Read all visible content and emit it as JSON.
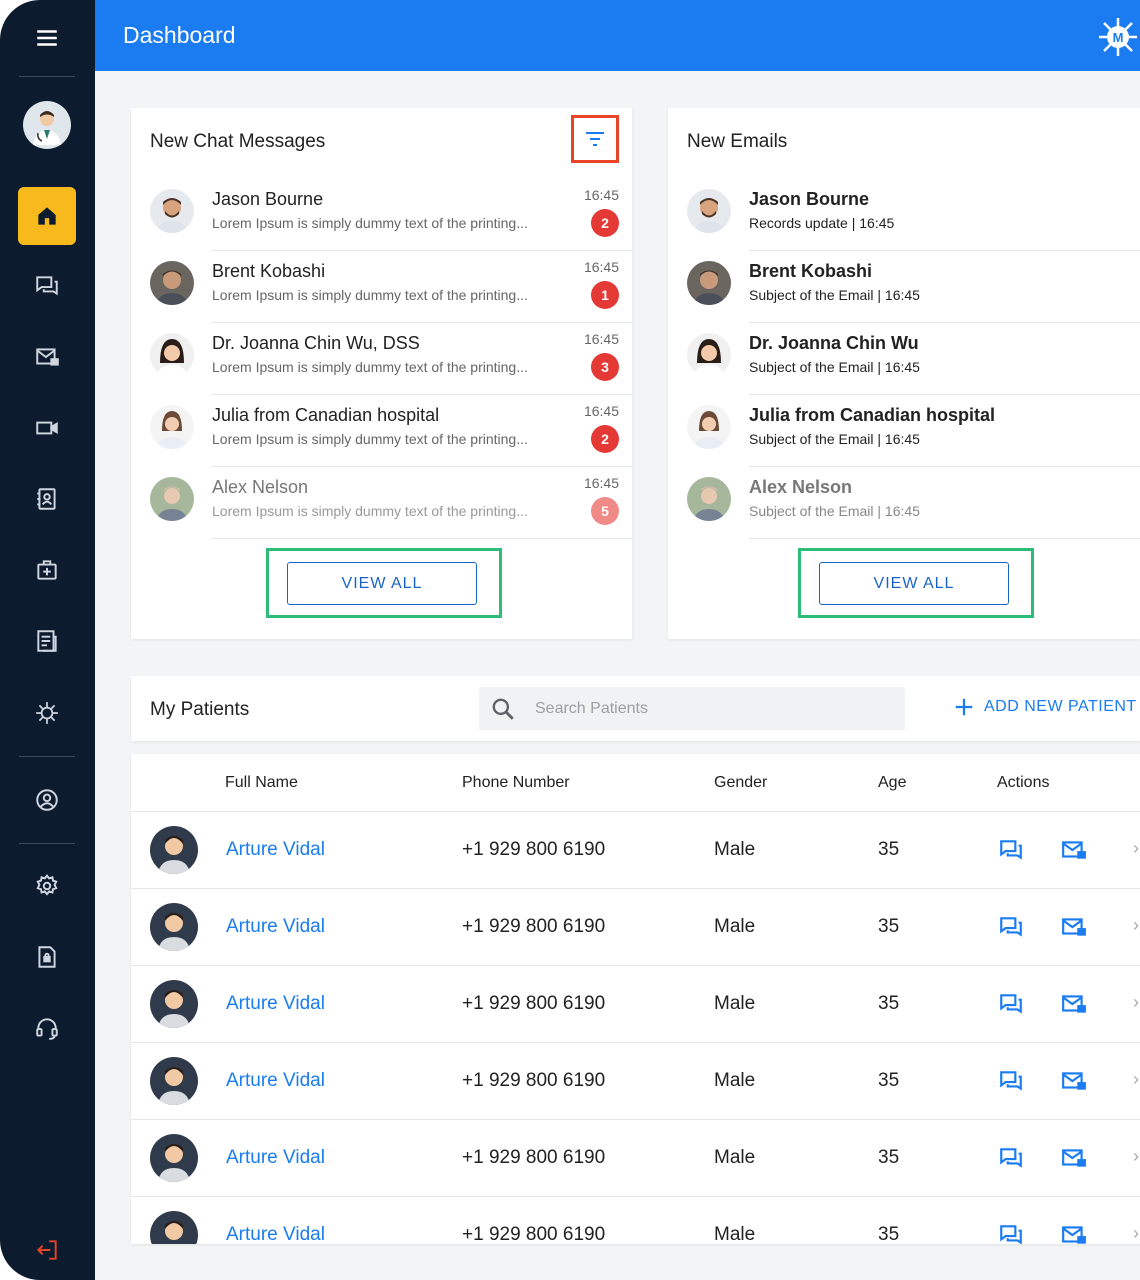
{
  "header": {
    "title": "Dashboard"
  },
  "chat_card": {
    "title": "New Chat Messages",
    "view_all": "VIEW ALL",
    "items": [
      {
        "name": "Jason Bourne",
        "preview": "Lorem Ipsum is simply dummy text of the printing...",
        "time": "16:45",
        "count": "2"
      },
      {
        "name": "Brent Kobashi",
        "preview": "Lorem Ipsum is simply dummy text of the printing...",
        "time": "16:45",
        "count": "1"
      },
      {
        "name": "Dr. Joanna Chin Wu, DSS",
        "preview": "Lorem Ipsum is simply dummy text of the printing...",
        "time": "16:45",
        "count": "3"
      },
      {
        "name": "Julia from Canadian hospital",
        "preview": "Lorem Ipsum is simply dummy text of the printing...",
        "time": "16:45",
        "count": "2"
      },
      {
        "name": "Alex Nelson",
        "preview": "Lorem Ipsum is simply dummy text of the printing...",
        "time": "16:45",
        "count": "5"
      }
    ]
  },
  "email_card": {
    "title": "New Emails",
    "view_all": "VIEW ALL",
    "items": [
      {
        "name": "Jason Bourne",
        "subject": "Records update | 16:45"
      },
      {
        "name": "Brent Kobashi",
        "subject": "Subject of the Email | 16:45"
      },
      {
        "name": "Dr. Joanna Chin Wu",
        "subject": "Subject of the Email | 16:45"
      },
      {
        "name": "Julia from Canadian hospital",
        "subject": "Subject of the Email | 16:45"
      },
      {
        "name": "Alex Nelson",
        "subject": "Subject of the Email | 16:45"
      }
    ]
  },
  "patients": {
    "title": "My Patients",
    "search_placeholder": "Search Patients",
    "add_label": "ADD NEW PATIENT",
    "columns": [
      "Full Name",
      "Phone Number",
      "Gender",
      "Age",
      "Actions"
    ],
    "rows": [
      {
        "name": "Arture Vidal",
        "phone": "+1 929 800 6190",
        "gender": "Male",
        "age": "35"
      },
      {
        "name": "Arture Vidal",
        "phone": "+1 929 800 6190",
        "gender": "Male",
        "age": "35"
      },
      {
        "name": "Arture Vidal",
        "phone": "+1 929 800 6190",
        "gender": "Male",
        "age": "35"
      },
      {
        "name": "Arture Vidal",
        "phone": "+1 929 800 6190",
        "gender": "Male",
        "age": "35"
      },
      {
        "name": "Arture Vidal",
        "phone": "+1 929 800 6190",
        "gender": "Male",
        "age": "35"
      },
      {
        "name": "Arture Vidal",
        "phone": "+1 929 800 6190",
        "gender": "Male",
        "age": "35"
      }
    ]
  },
  "sidebar": {
    "icons": [
      "menu-icon",
      "avatar",
      "home-icon",
      "chat-icon",
      "email-icon",
      "video-icon",
      "contacts-icon",
      "medical-kit-icon",
      "document-icon",
      "virus-icon",
      "profile-icon",
      "settings-icon",
      "secure-file-icon",
      "headset-icon",
      "logout-icon"
    ]
  },
  "colors": {
    "accent": "#1a7cf0",
    "sidebar": "#0d1b2e",
    "active": "#f7b91c",
    "badge": "#e53935"
  }
}
